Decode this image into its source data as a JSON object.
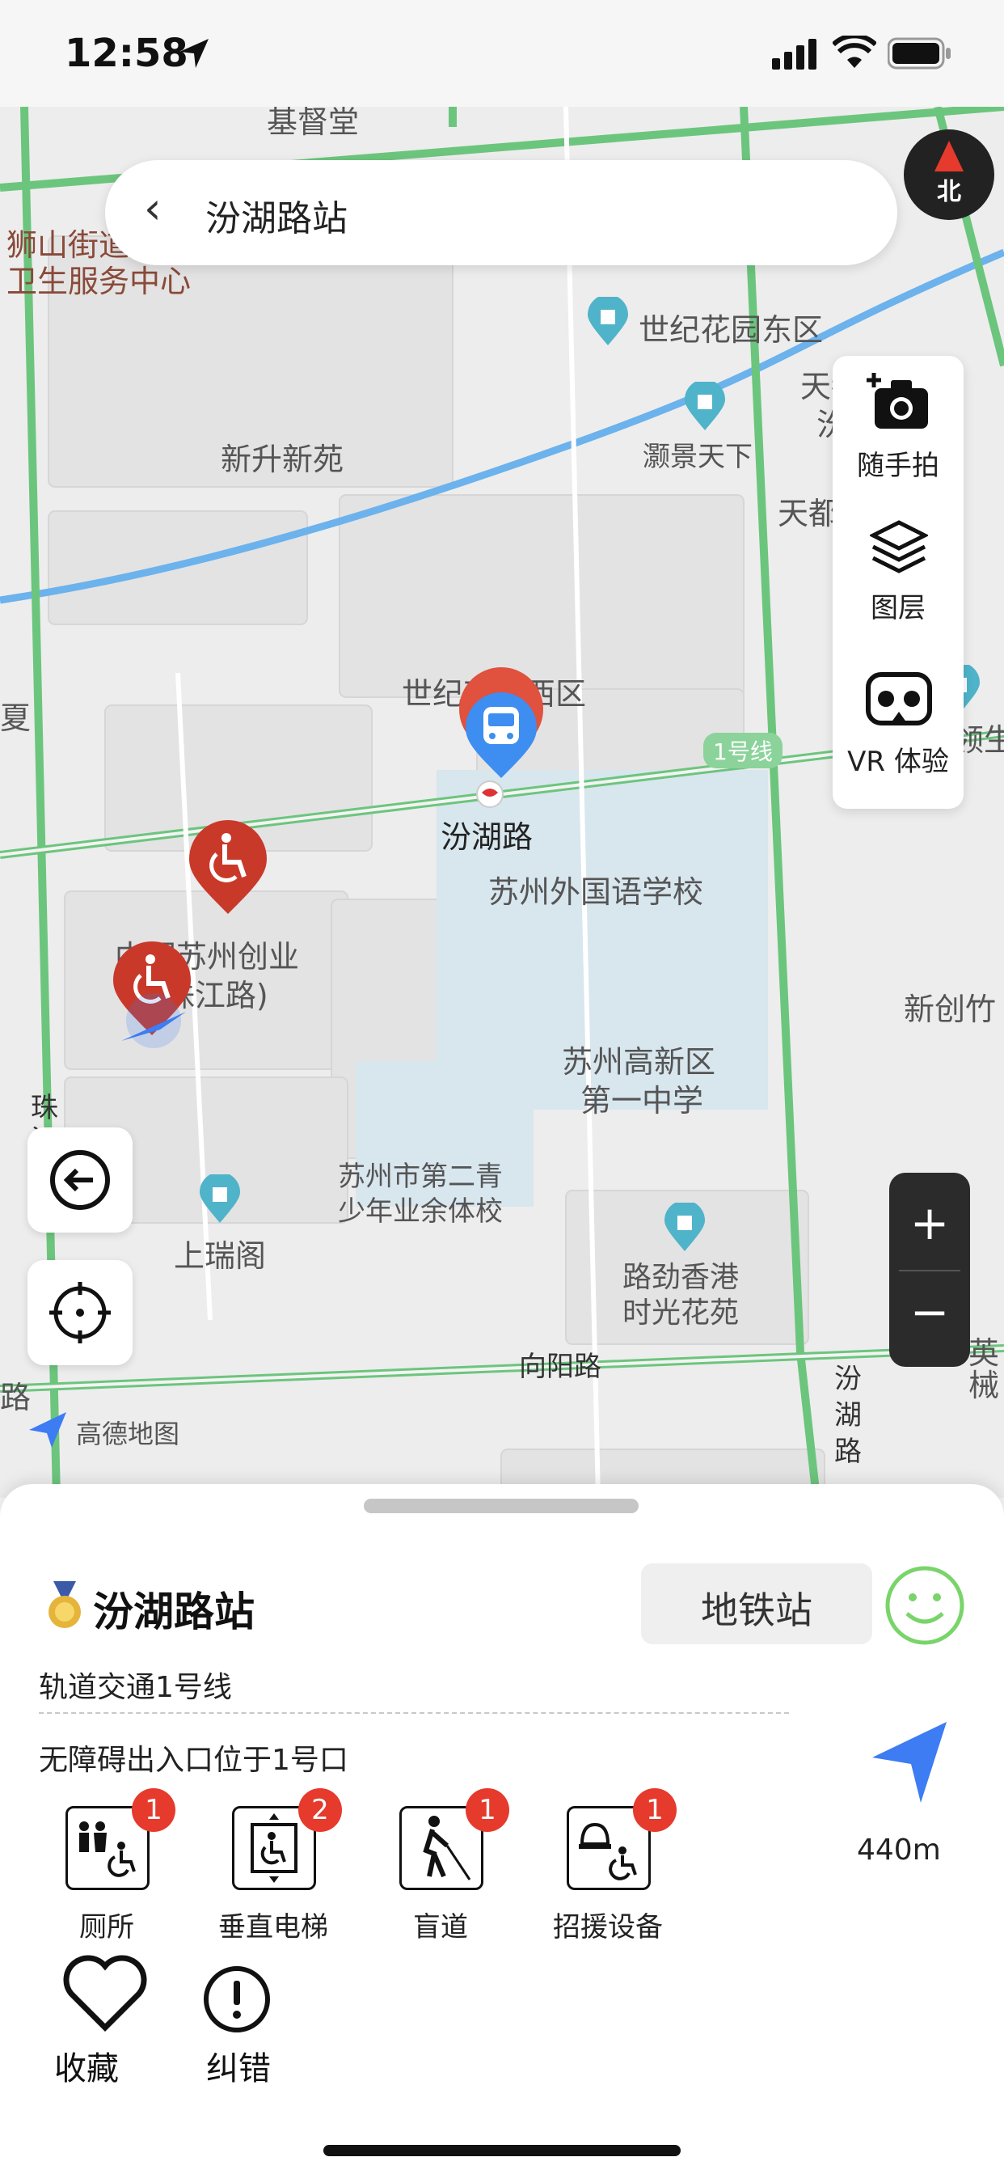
{
  "status_bar": {
    "time": "12:58"
  },
  "search": {
    "back_glyph": "‹",
    "title": "汾湖路站"
  },
  "compass": {
    "label": "北"
  },
  "map_tools": [
    {
      "label": "随手拍",
      "icon": "camera-plus-icon"
    },
    {
      "label": "图层",
      "icon": "layers-icon"
    },
    {
      "label": "VR 体验",
      "icon": "vr-headset-icon"
    }
  ],
  "zoom": {
    "in": "+",
    "out": "−"
  },
  "map": {
    "labels": [
      "基督堂",
      "狮山街道",
      "卫生服务中心",
      "世纪花园东区",
      "天都花园(",
      "汾湖",
      "天都花园南区",
      "新升新苑",
      "灏景天下",
      "世纪花园西区",
      "新区白领生",
      "夏",
      "汾湖路",
      "苏州外国语学校",
      "中国苏州创业",
      "(珠江路)",
      "新创竹",
      "苏州高新区",
      "第一中学",
      "珠",
      "江",
      "路",
      "苏州市第二青",
      "少年业余体校",
      "上瑞阁",
      "路劲香港",
      "时光花苑",
      "向阳路",
      "汾",
      "湖",
      "路",
      "英",
      "械",
      "路"
    ],
    "line_badge": "1号线",
    "brand": "高德地图"
  },
  "sheet": {
    "station_name": "汾湖路站",
    "type_tag": "地铁站",
    "line_info": "轨道交通1号线",
    "accessible_entrance": "无障碍出入口位于1号口",
    "distance": "440m",
    "facilities": [
      {
        "name": "厕所",
        "count": "1",
        "icon": "accessible-toilet-icon"
      },
      {
        "name": "垂直电梯",
        "count": "2",
        "icon": "elevator-icon"
      },
      {
        "name": "盲道",
        "count": "1",
        "icon": "blind-path-icon"
      },
      {
        "name": "招援设备",
        "count": "1",
        "icon": "assistance-bell-icon"
      }
    ],
    "actions": {
      "favorite": "收藏",
      "report": "纠错"
    }
  },
  "colors": {
    "accent_blue": "#3d7cf2",
    "badge_red": "#e53a2c",
    "road_green": "#6cc57d",
    "smile_green": "#79d46a",
    "water_blue": "#6cb2ec"
  }
}
